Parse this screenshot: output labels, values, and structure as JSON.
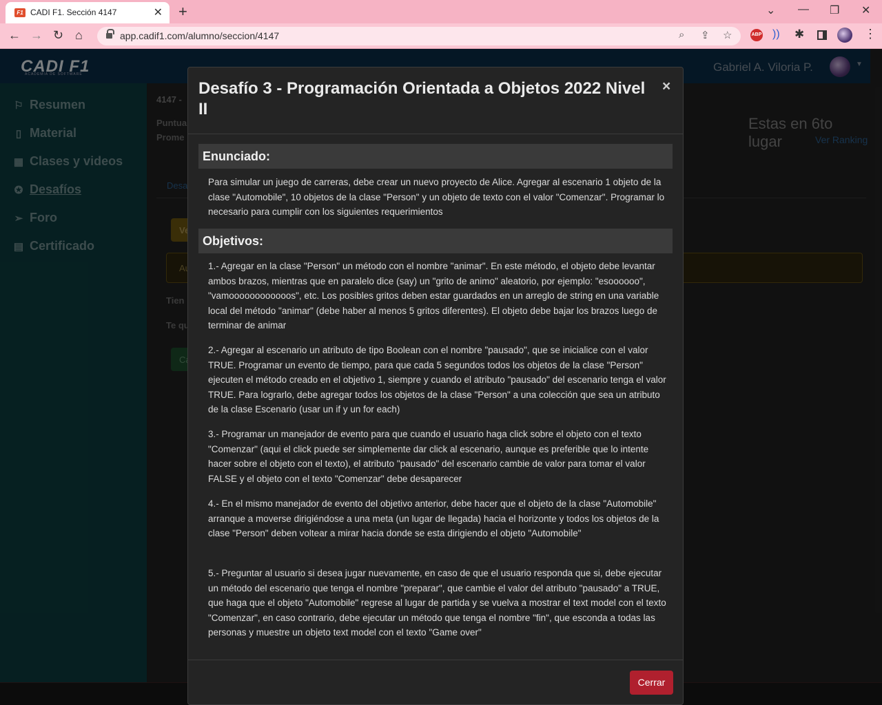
{
  "browser": {
    "tab_title": "CADI F1. Sección 4147",
    "favicon_text": "F1",
    "url": "app.cadif1.com/alumno/seccion/4147"
  },
  "app": {
    "logo": "CADI F1",
    "logo_sub": "ACADEMIA DE SOFTWARE",
    "user_name": "Gabriel A. Viloria P.",
    "sidebar": [
      {
        "label": "Resumen",
        "icon": "flag-icon"
      },
      {
        "label": "Material",
        "icon": "book-icon"
      },
      {
        "label": "Clases y videos",
        "icon": "calendar-icon"
      },
      {
        "label": "Desafíos",
        "icon": "badge-icon",
        "active": true
      },
      {
        "label": "Foro",
        "icon": "send-icon"
      },
      {
        "label": "Certificado",
        "icon": "certificate-icon"
      }
    ],
    "content": {
      "section_code": "4147 -",
      "puntua": "Puntua",
      "promedio": "Prome",
      "tab_partial": "Desa",
      "btn_partial": "Ve",
      "alert_partial": "Au",
      "tiene_partial": "Tien",
      "tequ_partial": "Te qu",
      "green_partial": "Ca",
      "ranking_position": "Estas en 6to lugar",
      "ranking_link": "Ver Ranking"
    }
  },
  "modal": {
    "title": "Desafío 3 - Programación Orientada a Objetos 2022 Nivel II",
    "close_label": "×",
    "enunciado_heading": "Enunciado:",
    "enunciado_text": "Para simular un juego de carreras, debe crear un nuevo proyecto de Alice. Agregar al escenario 1 objeto de la clase \"Automobile\", 10 objetos de la clase \"Person\" y un objeto de texto con el valor \"Comenzar\". Programar lo necesario para cumplir con los siguientes requerimientos",
    "objetivos_heading": "Objetivos:",
    "objetivos": [
      "1.- Agregar en la clase \"Person\" un método con el nombre \"animar\". En este método, el objeto debe levantar ambos brazos, mientras que en paralelo dice (say) un \"grito de animo\" aleatorio, por ejemplo: \"esoooooo\", \"vamoooooooooooos\", etc. Los posibles gritos deben estar guardados en un arreglo de string en una variable local del método \"animar\" (debe haber al menos 5 gritos diferentes). El objeto debe bajar los brazos luego de terminar de animar",
      "2.- Agregar al escenario un atributo de tipo Boolean con el nombre \"pausado\", que se inicialice con el valor TRUE. Programar un evento de tiempo, para que cada 5 segundos todos los objetos de la clase \"Person\" ejecuten el método creado en el objetivo 1, siempre y cuando el atributo \"pausado\" del escenario tenga el valor TRUE. Para lograrlo, debe agregar todos los objetos de la clase \"Person\" a una colección que sea un atributo de la clase Escenario (usar un if y un for each)",
      "3.- Programar un manejador de evento para que cuando el usuario haga click sobre el objeto con el texto \"Comenzar\" (aqui el click puede ser simplemente dar click al escenario, aunque es preferible que lo intente hacer sobre el objeto con el texto), el atributo \"pausado\" del escenario cambie de valor para tomar el valor FALSE y el objeto con el texto \"Comenzar\" debe desaparecer",
      "4.- En el mismo manejador de evento del objetivo anterior, debe hacer que el objeto de la clase \"Automobile\" arranque a moverse dirigiéndose a una meta (un lugar de llegada) hacia el horizonte y todos los objetos de la clase \"Person\" deben voltear a mirar hacia donde se esta dirigiendo el objeto \"Automobile\"",
      "5.- Preguntar al usuario si desea jugar nuevamente, en caso de que el usuario responda que si, debe ejecutar un método del escenario que tenga el nombre \"preparar\", que cambie el valor del atributo \"pausado\" a TRUE, que haga que el objeto \"Automobile\" regrese al lugar de partida y se vuelva a mostrar el text model con el texto \"Comenzar\", en caso contrario, debe ejecutar un método que tenga el nombre \"fin\", que esconda a todas las personas y muestre un objeto text model con el texto \"Game over\""
    ],
    "close_button": "Cerrar"
  }
}
